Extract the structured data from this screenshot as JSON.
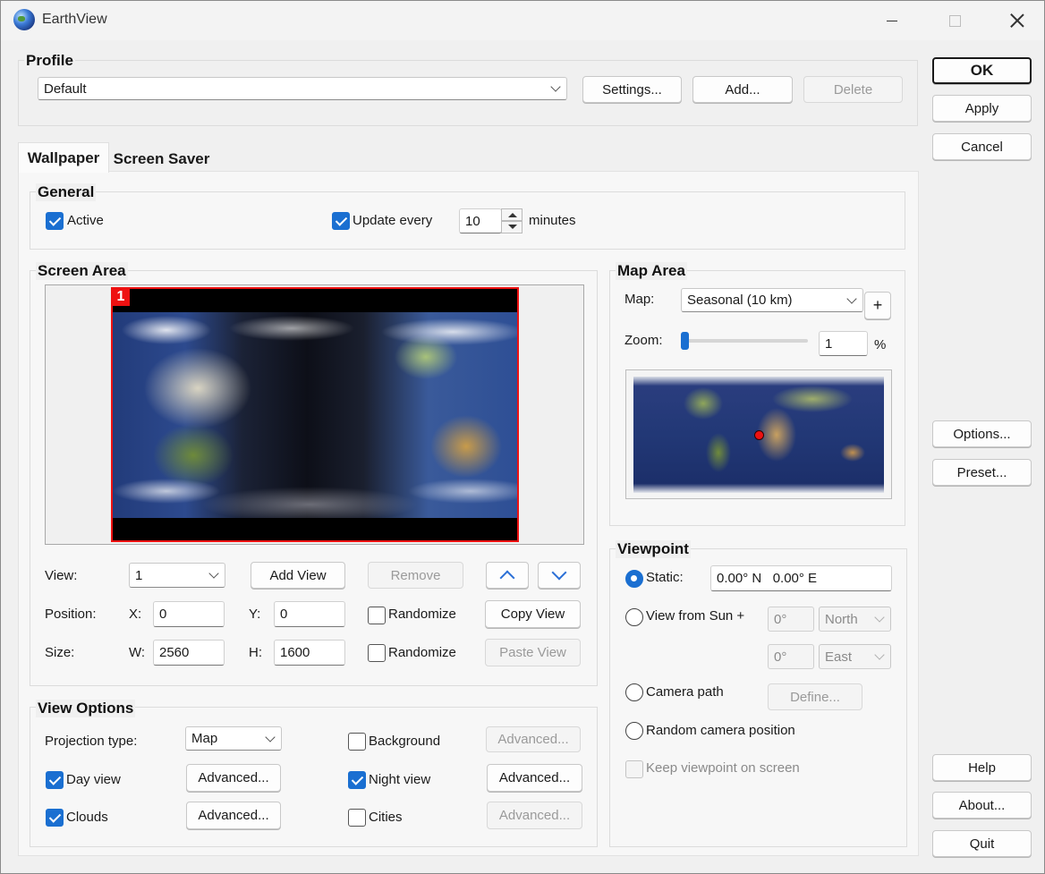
{
  "window": {
    "title": "EarthView"
  },
  "profile": {
    "title": "Profile",
    "selected": "Default",
    "settings_label": "Settings...",
    "add_label": "Add...",
    "delete_label": "Delete"
  },
  "side_buttons": {
    "ok": "OK",
    "apply": "Apply",
    "cancel": "Cancel",
    "options": "Options...",
    "preset": "Preset...",
    "help": "Help",
    "about": "About...",
    "quit": "Quit"
  },
  "tabs": [
    {
      "label": "Wallpaper"
    },
    {
      "label": "Screen Saver"
    }
  ],
  "general": {
    "title": "General",
    "active_label": "Active",
    "active_checked": true,
    "update_label": "Update every",
    "update_checked": true,
    "update_value": "10",
    "update_unit": "minutes"
  },
  "screen_area": {
    "title": "Screen Area",
    "monitor_badge": "1",
    "view_label": "View:",
    "view_value": "1",
    "add_view": "Add View",
    "remove": "Remove",
    "position_label": "Position:",
    "x_label": "X:",
    "x_value": "0",
    "y_label": "Y:",
    "y_value": "0",
    "randomize_label": "Randomize",
    "copy_view": "Copy View",
    "size_label": "Size:",
    "w_label": "W:",
    "w_value": "2560",
    "h_label": "H:",
    "h_value": "1600",
    "randomize2_label": "Randomize",
    "paste_view": "Paste View"
  },
  "view_options": {
    "title": "View Options",
    "projection_label": "Projection type:",
    "projection_value": "Map",
    "background_label": "Background",
    "background_checked": false,
    "day_label": "Day view",
    "day_checked": true,
    "night_label": "Night view",
    "night_checked": true,
    "clouds_label": "Clouds",
    "clouds_checked": true,
    "cities_label": "Cities",
    "cities_checked": false,
    "advanced_label": "Advanced..."
  },
  "map_area": {
    "title": "Map Area",
    "map_label": "Map:",
    "map_value": "Seasonal (10 km)",
    "plus_label": "+",
    "zoom_label": "Zoom:",
    "zoom_value": "1",
    "zoom_unit": "%",
    "zoom_level": 0.01
  },
  "viewpoint": {
    "title": "Viewpoint",
    "static_label": "Static:",
    "static_value": "0.00° N   0.00° E",
    "sun_label": "View from Sun +",
    "sun_deg1": "0°",
    "sun_dir1": "North",
    "sun_deg2": "0°",
    "sun_dir2": "East",
    "camera_label": "Camera path",
    "define_label": "Define...",
    "random_label": "Random camera position",
    "keep_label": "Keep viewpoint on screen"
  },
  "colors": {
    "accent": "#1a6fd1",
    "marker": "#ee1111"
  },
  "icons": [
    "earth-app-icon",
    "minimize-icon",
    "maximize-icon",
    "close-icon",
    "chevron-down-icon",
    "arrow-up-icon",
    "arrow-down-icon"
  ]
}
